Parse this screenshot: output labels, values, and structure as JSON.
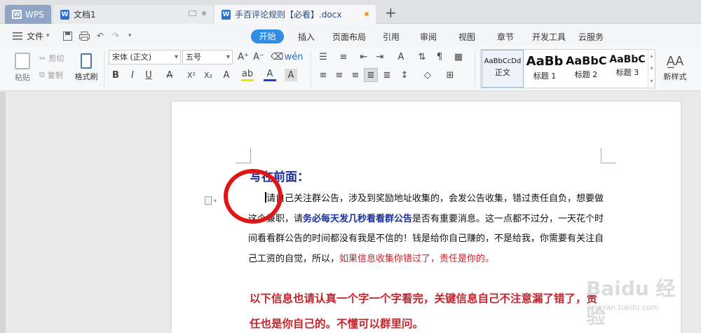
{
  "tabs": {
    "wps_label": "WPS",
    "doc1_title": "文档1",
    "doc2_title": "手百评论规则【必看】.docx",
    "new_tab": "+"
  },
  "menu": {
    "file_label": "文件",
    "ribbon_tabs": [
      "开始",
      "插入",
      "页面布局",
      "引用",
      "审阅",
      "视图",
      "章节",
      "开发工具",
      "云服务"
    ],
    "active_tab": "开始"
  },
  "ribbon": {
    "paste_label": "粘贴",
    "cut_label": "剪切",
    "copy_label": "复制",
    "format_painter_label": "格式刷",
    "font_name": "宋体 (正文)",
    "font_size": "五号",
    "styles": [
      {
        "sample": "AaBbCcDd",
        "name": "正文"
      },
      {
        "sample": "AaBb",
        "name": "标题 1"
      },
      {
        "sample": "AaBbC",
        "name": "标题 2"
      },
      {
        "sample": "AaBbC",
        "name": "标题 3"
      }
    ],
    "new_style_label": "新样式"
  },
  "document": {
    "heading": "写在前面：",
    "p1_start": "请自己关注群公告，涉及到奖励地址收集的，会发公告收集，错过责任自负，想要做这个兼职，请",
    "p1_bold": "务必每天发几秒看看群公告",
    "p1_mid": "是否有重要消息。这一点都不过分，一天花个时间看看群公告的时间都没有我是不信的！钱是给你自己赚的，不是给我，你需要有关注自己工资的自觉，所以，",
    "p1_red": "如果信息收集你错过了，责任是你的。",
    "p2": "以下信息也请认真一个字一个字看完，关键信息自己不注意漏了错了，责任也是你自己的。不懂可以群里问。"
  },
  "watermark": {
    "main": "Baidu 经验",
    "sub": "jingyan.baidu.com"
  },
  "colors": {
    "accent": "#2f8de4",
    "heading_blue": "#1b2f9a",
    "alert_red": "#c8232c",
    "annotation_red": "#e01616"
  }
}
